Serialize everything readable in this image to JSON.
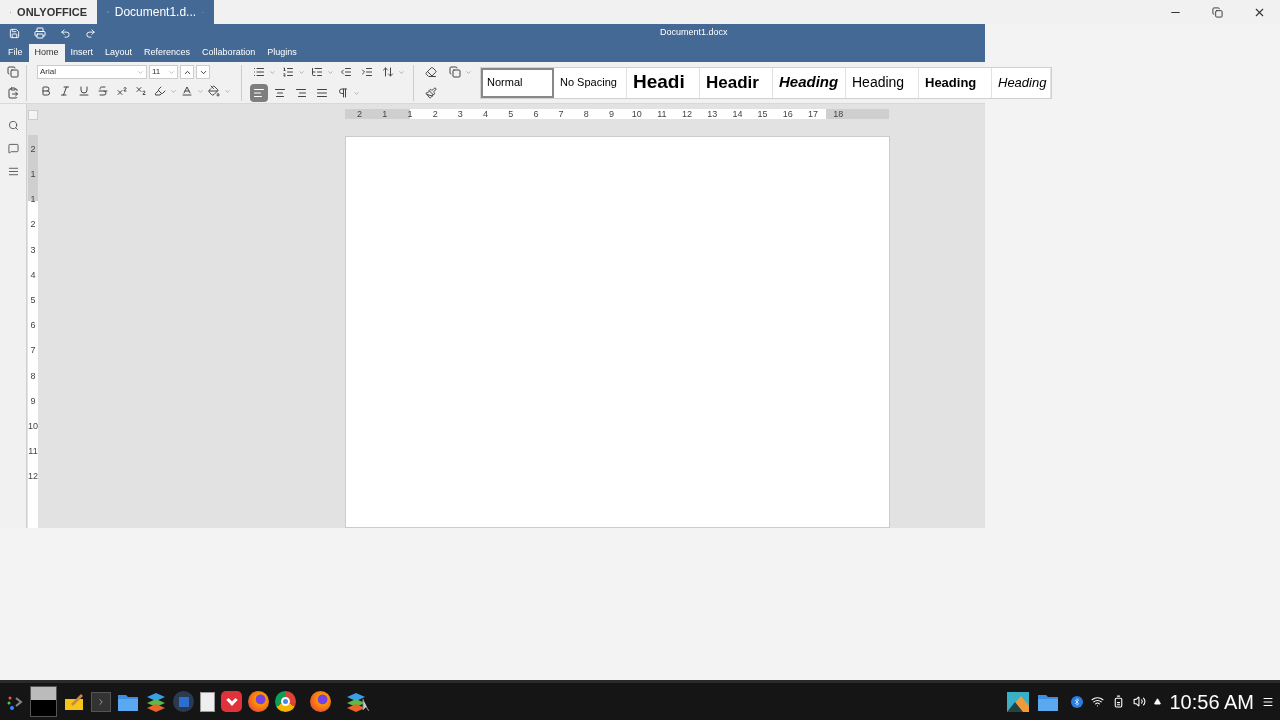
{
  "app_tabs": [
    {
      "kind": "home",
      "label": "ONLYOFFICE",
      "selected": false
    },
    {
      "kind": "document",
      "label": "Document1.d...",
      "selected": true
    }
  ],
  "window_title": "Document1.docx",
  "ribbon_tabs": [
    {
      "label": "File",
      "selected": false
    },
    {
      "label": "Home",
      "selected": true
    },
    {
      "label": "Insert",
      "selected": false
    },
    {
      "label": "Layout",
      "selected": false
    },
    {
      "label": "References",
      "selected": false
    },
    {
      "label": "Collaboration",
      "selected": false
    },
    {
      "label": "Plugins",
      "selected": false
    }
  ],
  "font": {
    "name": "Arial",
    "size": "11"
  },
  "styles": [
    {
      "label": "Normal",
      "kind": "normal",
      "selected": true
    },
    {
      "label": "No Spacing",
      "kind": "normal",
      "selected": false
    },
    {
      "label": "Headi",
      "kind": "h1",
      "selected": false
    },
    {
      "label": "Headir",
      "kind": "h2",
      "selected": false
    },
    {
      "label": "Heading",
      "kind": "h3",
      "selected": false
    },
    {
      "label": "Heading",
      "kind": "h4",
      "selected": false
    },
    {
      "label": "Heading",
      "kind": "h5",
      "selected": false
    },
    {
      "label": "Heading",
      "kind": "h6",
      "selected": false
    }
  ],
  "ruler": {
    "h_labels": [
      "2",
      "1",
      "1",
      "2",
      "3",
      "4",
      "5",
      "6",
      "7",
      "8",
      "9",
      "10",
      "11",
      "12",
      "13",
      "14",
      "15",
      "16",
      "17",
      "18"
    ],
    "v_labels": [
      "2",
      "1",
      "1",
      "2",
      "3",
      "4",
      "5",
      "6",
      "7",
      "8",
      "9",
      "10",
      "11",
      "12"
    ]
  },
  "taskbar": {
    "clock": "10:56 AM"
  }
}
